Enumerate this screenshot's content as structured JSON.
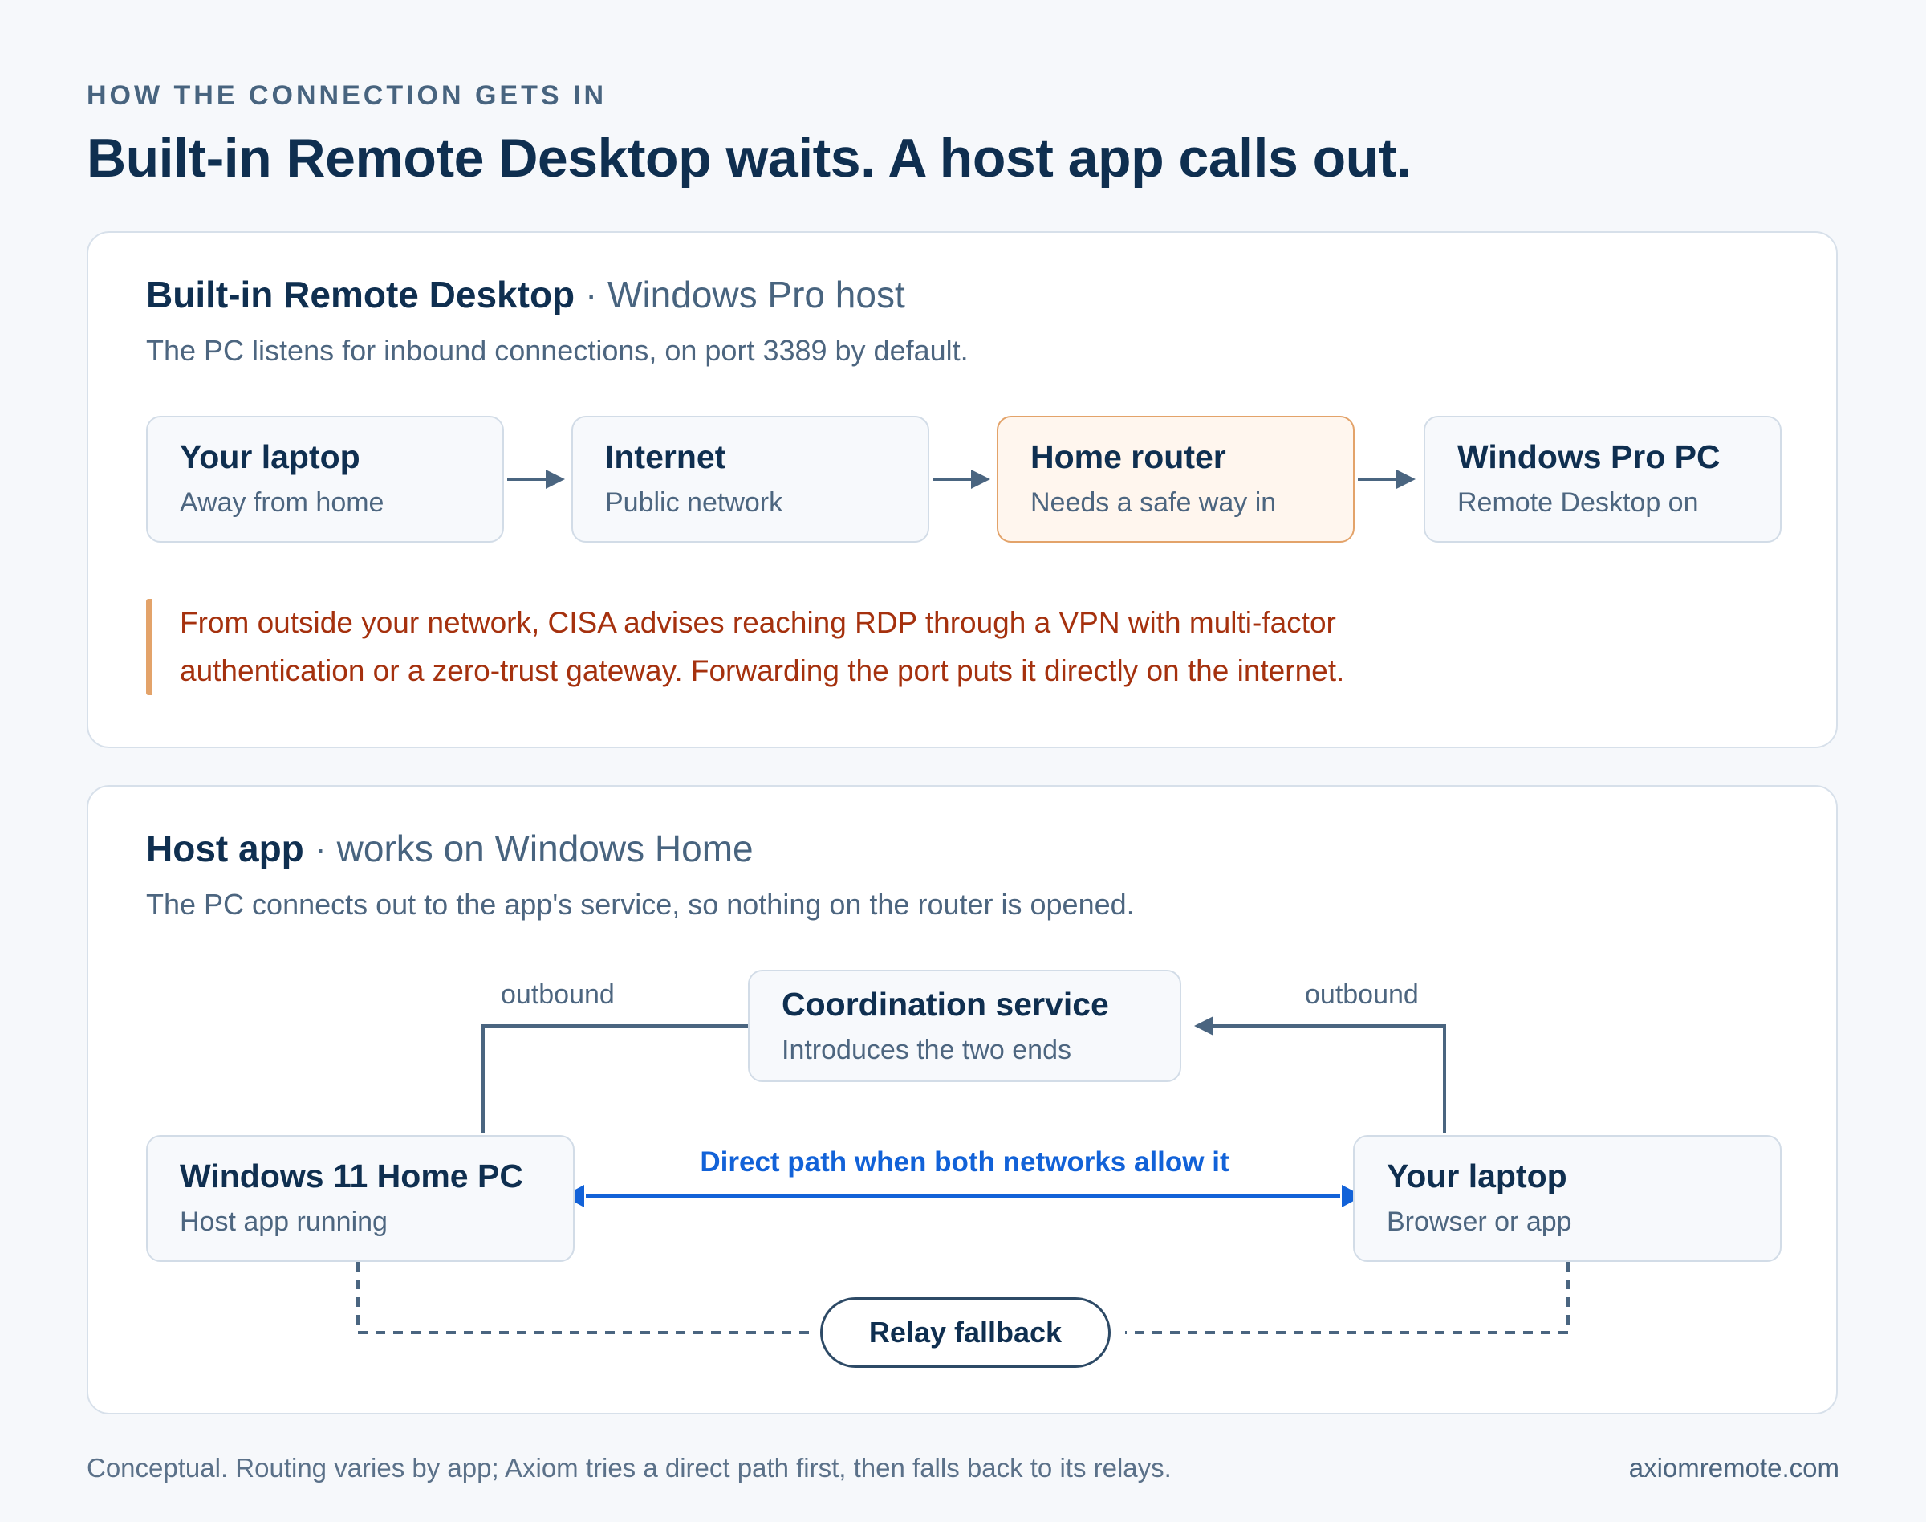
{
  "header": {
    "eyebrow": "HOW THE CONNECTION GETS IN",
    "title": "Built-in Remote Desktop waits. A host app calls out."
  },
  "rdp_card": {
    "title": "Built-in Remote Desktop",
    "subtitle": "· Windows Pro host",
    "description": "The PC listens for inbound connections, on port 3389 by default.",
    "nodes": [
      {
        "title": "Your laptop",
        "sub": "Away from home"
      },
      {
        "title": "Internet",
        "sub": "Public network"
      },
      {
        "title": "Home router",
        "sub": "Needs a safe way in"
      },
      {
        "title": "Windows Pro PC",
        "sub": "Remote Desktop on"
      }
    ],
    "warning_line1": "From outside your network, CISA advises reaching RDP through a VPN with multi-factor",
    "warning_line2": "authentication or a zero-trust gateway. Forwarding the port puts it directly on the internet."
  },
  "host_card": {
    "title": "Host app",
    "subtitle": "· works on Windows Home",
    "description": "The PC connects out to the app's service, so nothing on the router is opened.",
    "coordination": {
      "title": "Coordination service",
      "sub": "Introduces the two ends"
    },
    "home_pc": {
      "title": "Windows 11 Home PC",
      "sub": "Host app running"
    },
    "laptop": {
      "title": "Your laptop",
      "sub": "Browser or app"
    },
    "outbound_left": "outbound",
    "outbound_right": "outbound",
    "direct_label": "Direct path when both networks allow it",
    "relay_label": "Relay fallback"
  },
  "footer": {
    "note": "Conceptual. Routing varies by app; Axiom tries a direct path first, then falls back to its relays.",
    "site": "axiomremote.com"
  },
  "colors": {
    "navy": "#0f2f50",
    "arrow": "#4a6580",
    "warning_text": "#a5310e",
    "warning_accent": "#e3a36a",
    "direct_blue": "#1262d8"
  }
}
